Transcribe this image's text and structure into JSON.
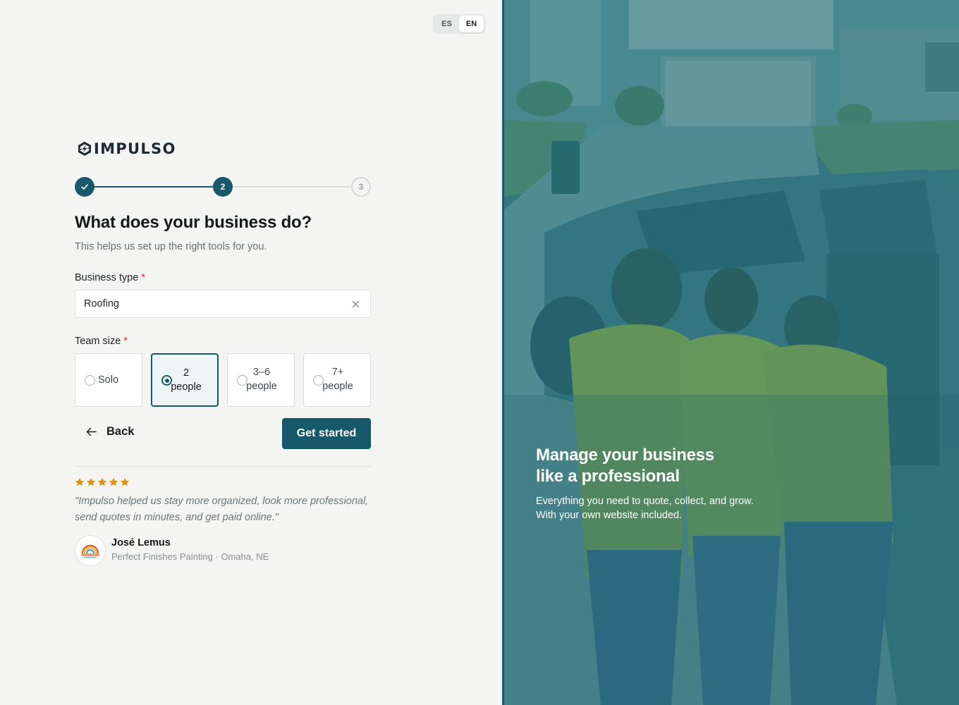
{
  "language_switcher": {
    "options": [
      "ES",
      "EN"
    ],
    "selected": "EN"
  },
  "brand": {
    "name": "IMPULSO"
  },
  "stepper": {
    "steps": [
      "",
      "2",
      "3"
    ],
    "current": 2,
    "total": 3
  },
  "form": {
    "title": "What does your business do?",
    "subtitle": "This helps us set up the right tools for you.",
    "business_type": {
      "label": "Business type",
      "required_mark": "*",
      "value": "Roofing"
    },
    "team_size": {
      "label": "Team size",
      "required_mark": "*",
      "options": [
        {
          "line1": "Solo",
          "line2": ""
        },
        {
          "line1": "2",
          "line2": "people"
        },
        {
          "line1": "3–6",
          "line2": "people"
        },
        {
          "line1": "7+",
          "line2": "people"
        }
      ],
      "selected_index": 1
    },
    "back_label": "Back",
    "submit_label": "Get started"
  },
  "testimonial": {
    "rating": 5,
    "quote": "\"Impulso helped us stay more organized, look more professional, send quotes in minutes, and get paid online.\"",
    "author": "José Lemus",
    "company": "Perfect Finishes Painting · Omaha, NE",
    "star_color": "#d9961a"
  },
  "hero": {
    "title_line1": "Manage your business",
    "title_line2": "like a professional",
    "subtitle_line1": "Everything you need to quote, collect, and grow.",
    "subtitle_line2": "With your own website included."
  },
  "colors": {
    "primary": "#17596a",
    "background": "#f4f4f2",
    "overlay": "#2a6f7a"
  }
}
